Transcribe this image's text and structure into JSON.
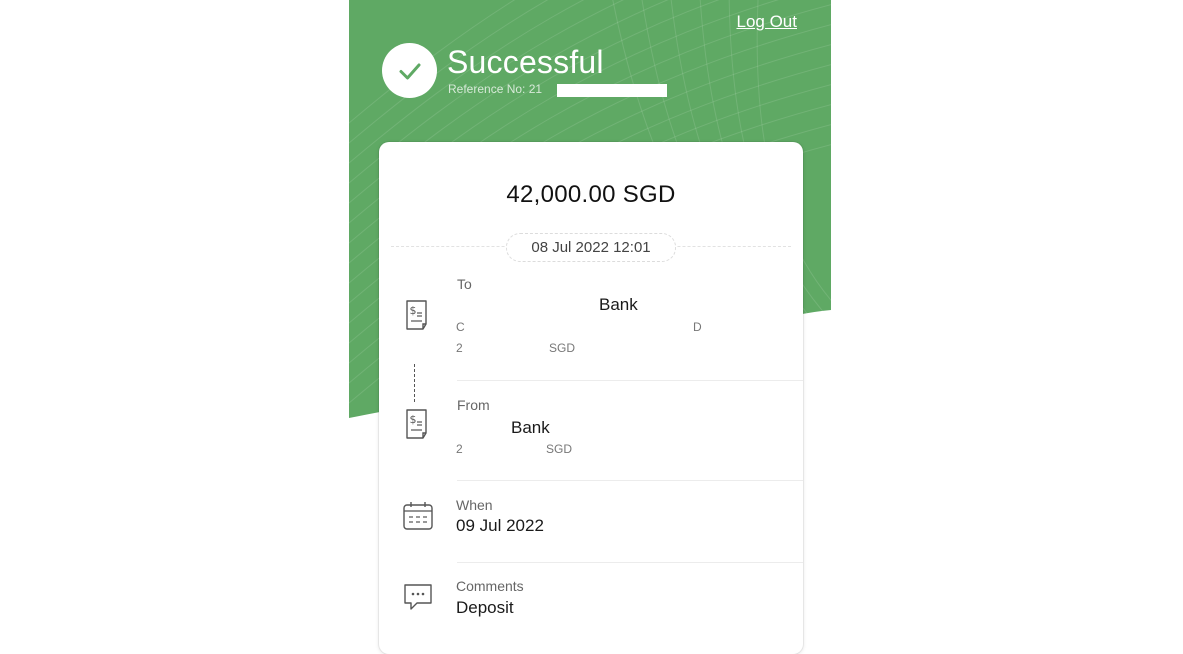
{
  "header": {
    "logout_label": "Log Out",
    "status_title": "Successful",
    "reference_label": "Reference No: 21"
  },
  "transfer": {
    "amount": "42,000.00 SGD",
    "timestamp": "08 Jul 2022 12:01"
  },
  "to": {
    "label": "To",
    "bank": "Bank",
    "line1_prefix": "C",
    "line1_suffix": "D",
    "line2_prefix": "2",
    "line2_suffix": "SGD"
  },
  "from": {
    "label": "From",
    "bank": "Bank",
    "line1_prefix": "2",
    "line1_suffix": "SGD"
  },
  "when": {
    "label": "When",
    "value": "09 Jul 2022"
  },
  "comments": {
    "label": "Comments",
    "value": "Deposit"
  },
  "colors": {
    "accent_green": "#5fa964",
    "card_bg": "#ffffff"
  },
  "icons": {
    "check": "check-icon",
    "to": "receipt-dollar-icon",
    "from": "receipt-dollar-icon",
    "when": "calendar-icon",
    "comments": "chat-bubble-icon"
  }
}
